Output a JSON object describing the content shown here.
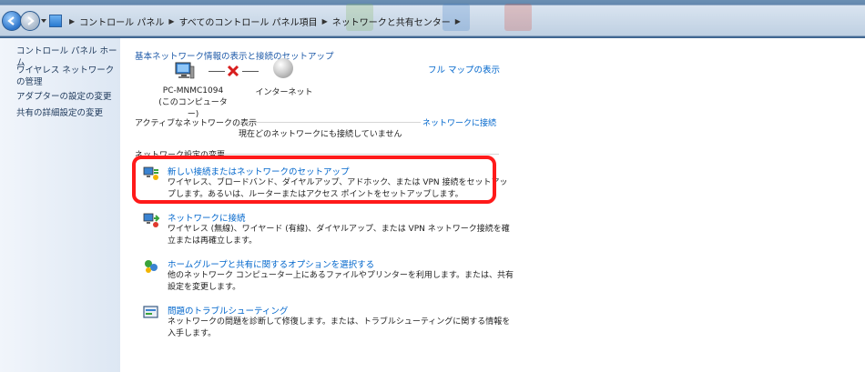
{
  "address_bar": {
    "breadcrumbs": [
      "コントロール パネル",
      "すべてのコントロール パネル項目",
      "ネットワークと共有センター"
    ]
  },
  "sidebar": {
    "items": [
      {
        "label": "コントロール パネル ホーム"
      },
      {
        "label": "ワイヤレス ネットワークの管理"
      },
      {
        "label": "アダプターの設定の変更"
      },
      {
        "label": "共有の詳細設定の変更"
      }
    ]
  },
  "main": {
    "title": "基本ネットワーク情報の表示と接続のセットアップ",
    "full_map_link": "フル マップの表示",
    "computer_name": "PC-MNMC1094",
    "computer_caption": "(このコンピューター)",
    "internet_label": "インターネット",
    "active_networks_label": "アクティブなネットワークの表示",
    "connect_link": "ネットワークに接続",
    "no_connection_text": "現在どのネットワークにも接続していません",
    "change_settings_label": "ネットワーク設定の変更",
    "tasks": [
      {
        "title": "新しい接続またはネットワークのセットアップ",
        "description": "ワイヤレス、ブロードバンド、ダイヤルアップ、アドホック、または VPN 接続をセットアップします。あるいは、ルーターまたはアクセス ポイントをセットアップします。",
        "icon": "network-setup-icon"
      },
      {
        "title": "ネットワークに接続",
        "description": "ワイヤレス (無線)、ワイヤード (有線)、ダイヤルアップ、または VPN ネットワーク接続を確立または再確立します。",
        "icon": "network-connect-icon"
      },
      {
        "title": "ホームグループと共有に関するオプションを選択する",
        "description": "他のネットワーク コンピューター上にあるファイルやプリンターを利用します。または、共有設定を変更します。",
        "icon": "homegroup-icon"
      },
      {
        "title": "問題のトラブルシューティング",
        "description": "ネットワークの問題を診断して修復します。または、トラブルシューティングに関する情報を入手します。",
        "icon": "troubleshoot-icon"
      }
    ]
  },
  "colors": {
    "link": "#0066cc",
    "highlight": "#ff1a1a",
    "sidebar_text": "#1e395b"
  }
}
